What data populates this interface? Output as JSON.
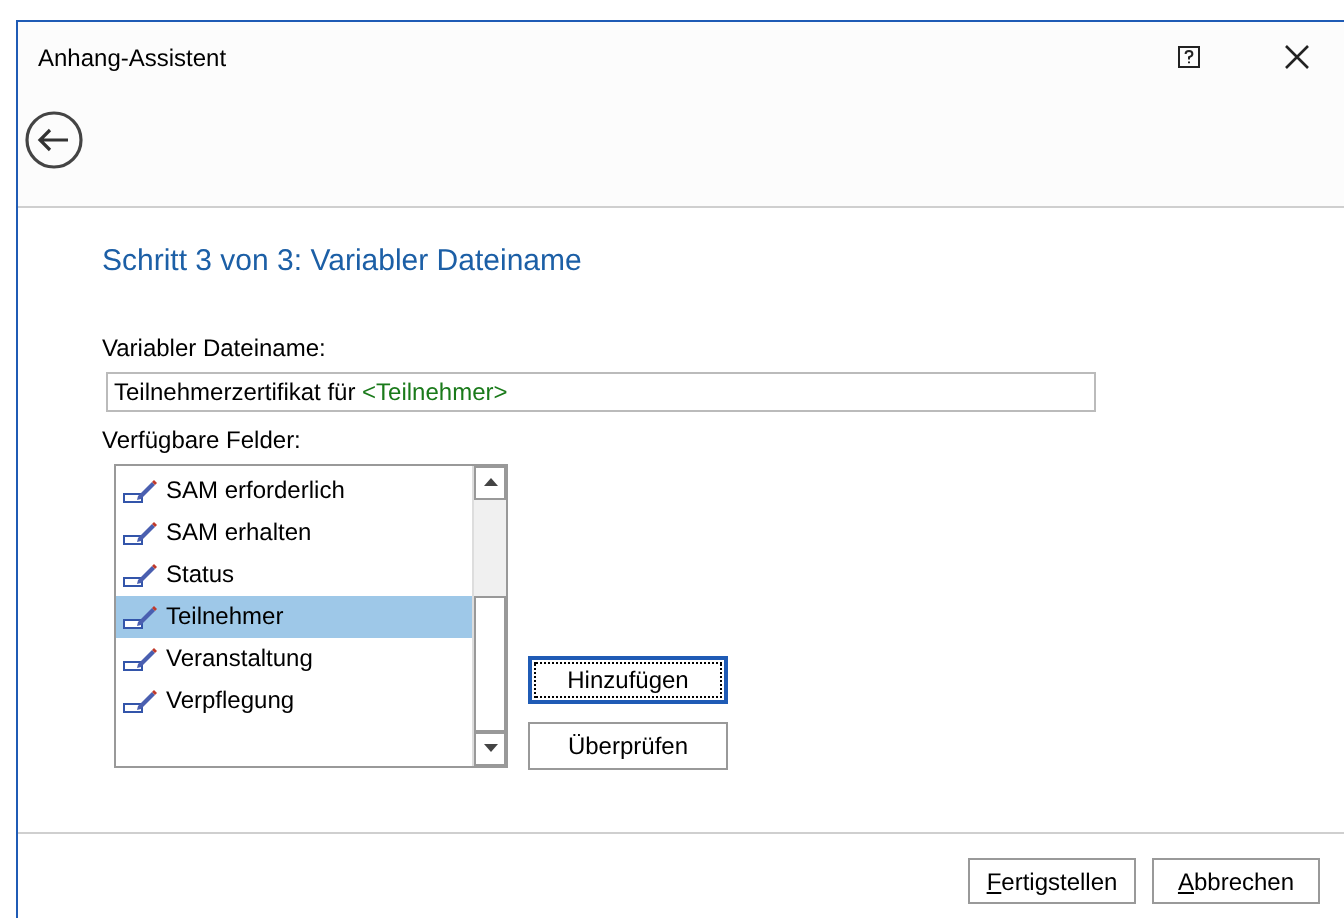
{
  "window": {
    "title": "Anhang-Assistent"
  },
  "step_title": "Schritt 3 von 3: Variabler Dateiname",
  "filename": {
    "label": "Variabler Dateiname:",
    "parts": [
      {
        "kind": "text",
        "text": "Teilnehmerzertifikat für "
      },
      {
        "kind": "field",
        "text": "<Teilnehmer>"
      }
    ]
  },
  "fields": {
    "label": "Verfügbare Felder:",
    "items": [
      {
        "label": "SAM erforderlich",
        "selected": false
      },
      {
        "label": "SAM erhalten",
        "selected": false
      },
      {
        "label": "Status",
        "selected": false
      },
      {
        "label": "Teilnehmer",
        "selected": true
      },
      {
        "label": "Veranstaltung",
        "selected": false
      },
      {
        "label": "Verpflegung",
        "selected": false
      }
    ]
  },
  "side_buttons": [
    {
      "label": "Hinzufügen",
      "focused": true
    },
    {
      "label": "Überprüfen",
      "focused": false
    }
  ],
  "footer_buttons": [
    {
      "mnemonic": "F",
      "rest": "ertigstellen"
    },
    {
      "mnemonic": "A",
      "rest": "bbrechen"
    }
  ]
}
